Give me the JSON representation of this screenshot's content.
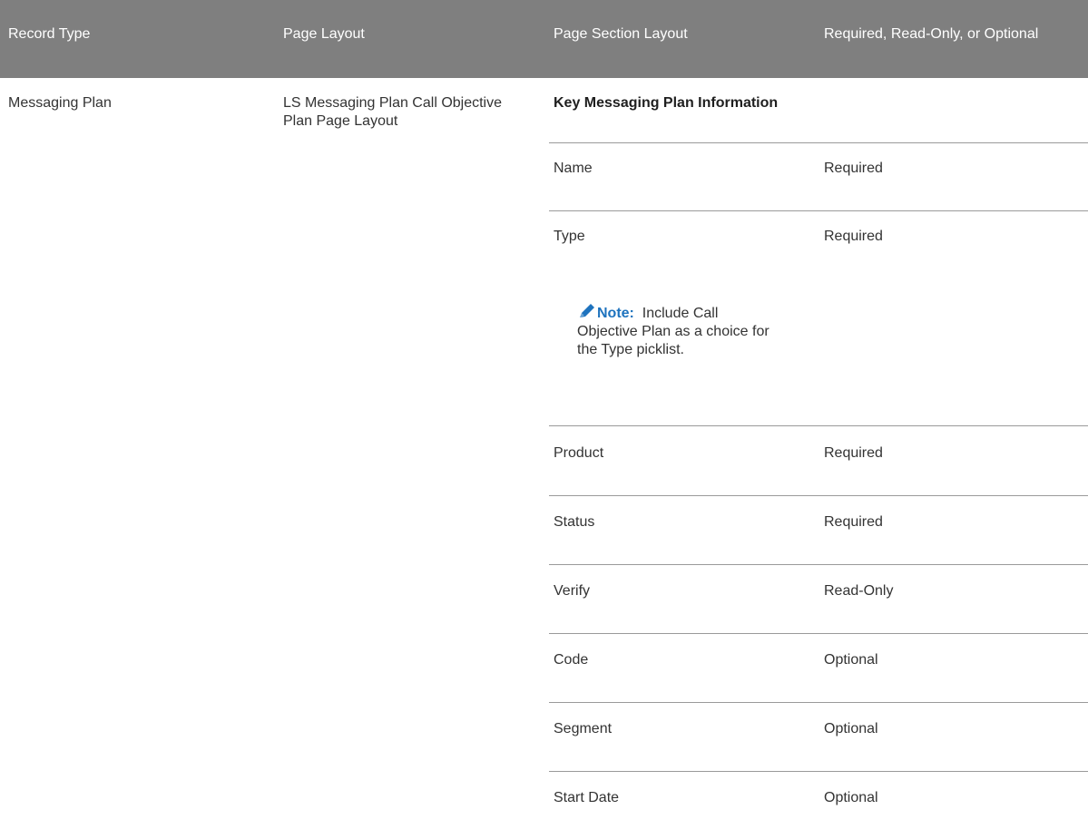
{
  "header": {
    "record_type": "Record Type",
    "page_layout": "Page Layout",
    "page_section_layout": "Page Section Layout",
    "required_status": "Required, Read-Only, or Optional"
  },
  "row": {
    "record_type": "Messaging Plan",
    "page_layout": "LS Messaging Plan Call Objective Plan Page Layout",
    "section_title": "Key Messaging Plan Information"
  },
  "fields": [
    {
      "name": "Name",
      "status": "Required"
    },
    {
      "name": "Type",
      "status": "Required"
    },
    {
      "name": "Product",
      "status": "Required"
    },
    {
      "name": "Status",
      "status": "Required"
    },
    {
      "name": "Verify",
      "status": "Read-Only"
    },
    {
      "name": "Code",
      "status": "Optional"
    },
    {
      "name": "Segment",
      "status": "Optional"
    },
    {
      "name": "Start Date",
      "status": "Optional"
    }
  ],
  "note": {
    "icon": "pencil-icon",
    "label": "Note:",
    "text": "Include Call Objective Plan as a choice for the Type picklist."
  },
  "colors": {
    "header_bg": "#7f7f7f",
    "note_accent": "#1e73be"
  }
}
